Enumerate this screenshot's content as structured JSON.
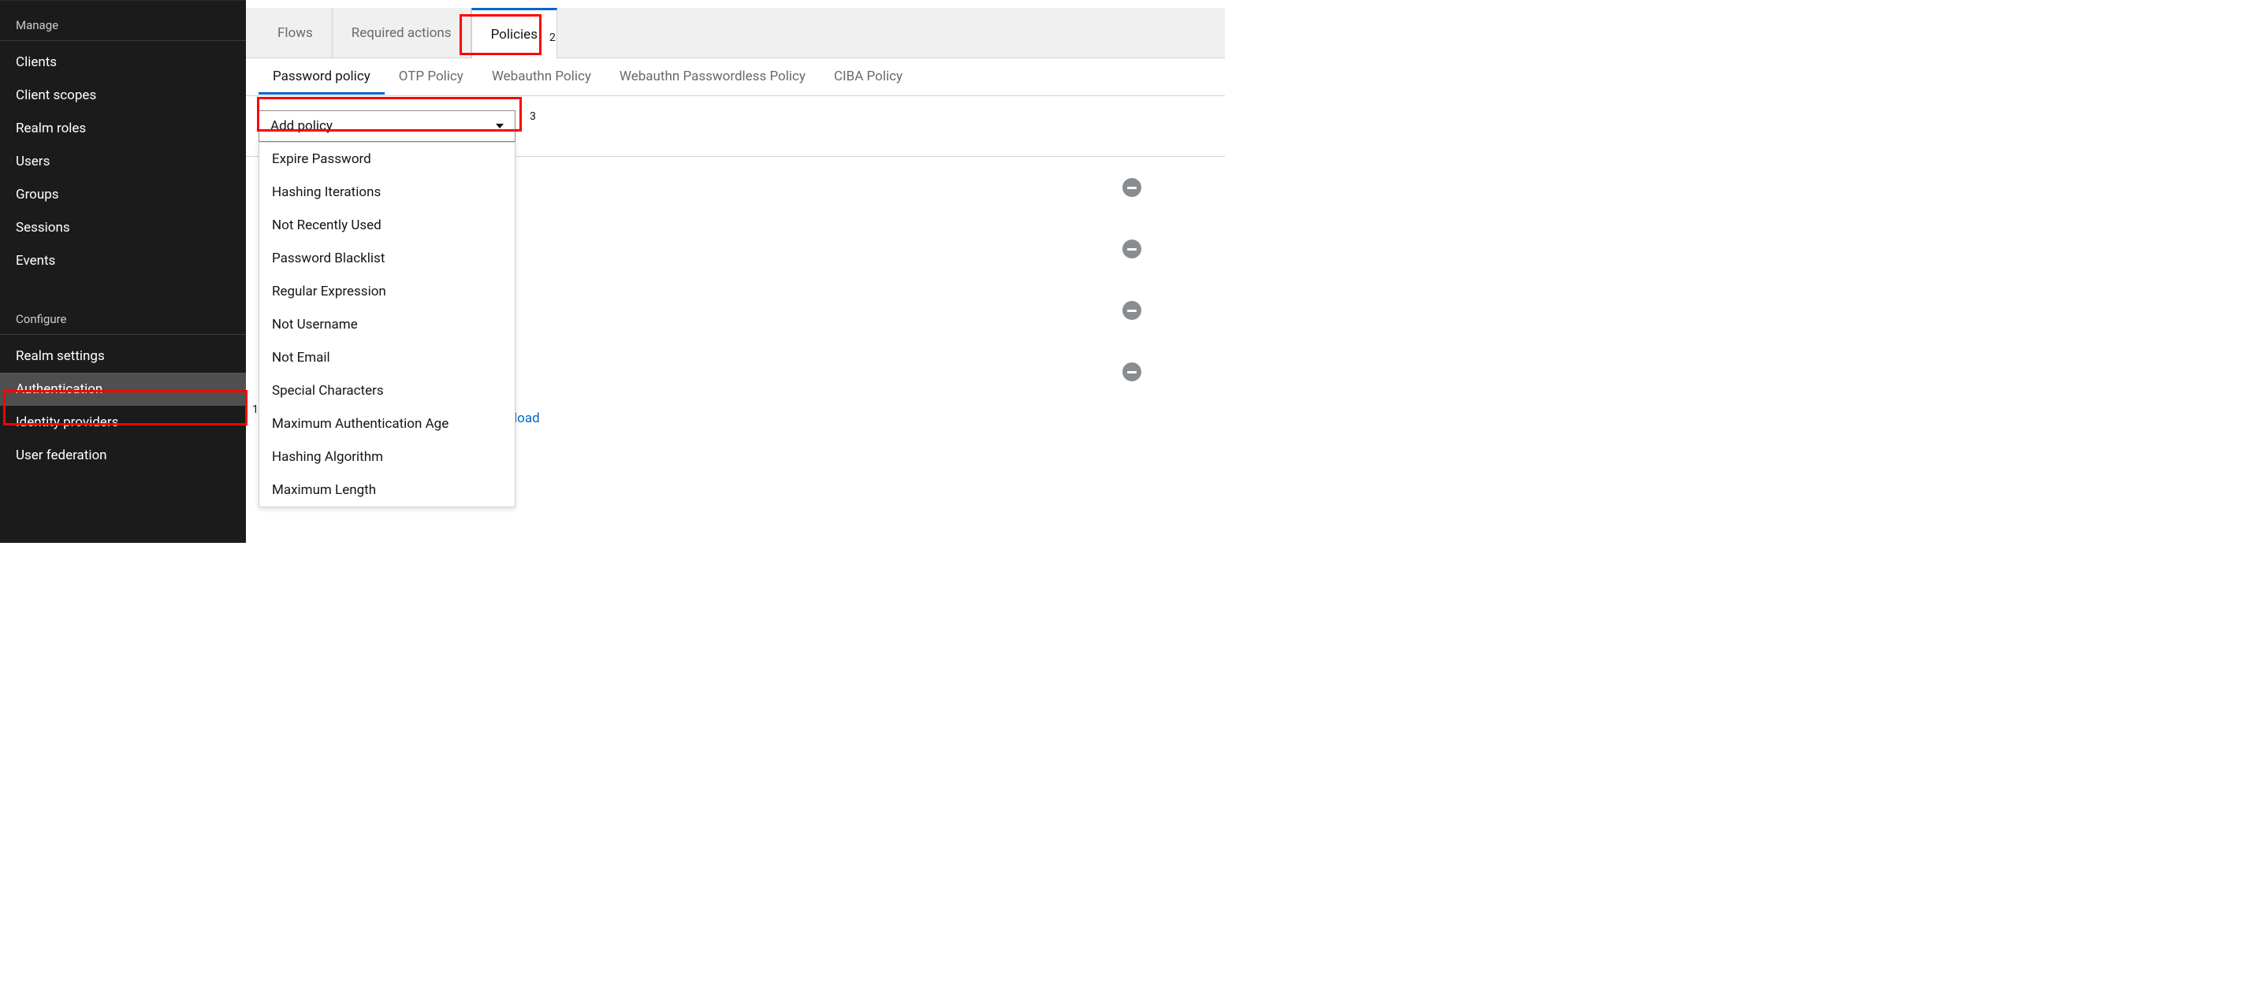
{
  "sidebar": {
    "manage_title": "Manage",
    "configure_title": "Configure",
    "manage_items": [
      "Clients",
      "Client scopes",
      "Realm roles",
      "Users",
      "Groups",
      "Sessions",
      "Events"
    ],
    "configure_items": [
      "Realm settings",
      "Authentication",
      "Identity providers",
      "User federation"
    ],
    "active_item": "Authentication"
  },
  "top_tabs": [
    "Flows",
    "Required actions",
    "Policies"
  ],
  "top_tab_active": "Policies",
  "sub_tabs": [
    "Password policy",
    "OTP Policy",
    "Webauthn Policy",
    "Webauthn Passwordless Policy",
    "CIBA Policy"
  ],
  "sub_tab_active": "Password policy",
  "dropdown": {
    "label": "Add policy",
    "options": [
      "Expire Password",
      "Hashing Iterations",
      "Not Recently Used",
      "Password Blacklist",
      "Regular Expression",
      "Not Username",
      "Not Email",
      "Special Characters",
      "Maximum Authentication Age",
      "Hashing Algorithm",
      "Maximum Length"
    ]
  },
  "stepper_plus": "+",
  "reload_text": "load",
  "annotations": {
    "one": "1",
    "two": "2",
    "three": "3"
  }
}
